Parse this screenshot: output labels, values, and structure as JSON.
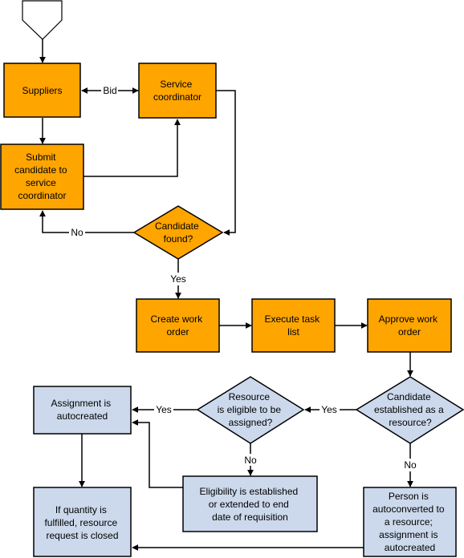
{
  "colors": {
    "process_orange": "#FFA500",
    "process_blue": "#CCD9EC",
    "stroke": "#000000",
    "background": "#FFFFFF"
  },
  "nodes": {
    "start": {
      "type": "off-page-connector",
      "label": ""
    },
    "suppliers": {
      "type": "process",
      "lines": [
        "Suppliers"
      ]
    },
    "service_coordinator": {
      "type": "process",
      "lines": [
        "Service",
        "coordinator"
      ]
    },
    "submit_candidate": {
      "type": "process",
      "lines": [
        "Submit",
        "candidate to",
        "service",
        "coordinator"
      ]
    },
    "candidate_found": {
      "type": "decision",
      "lines": [
        "Candidate",
        "found?"
      ]
    },
    "create_work_order": {
      "type": "process",
      "lines": [
        "Create work",
        "order"
      ]
    },
    "execute_task_list": {
      "type": "process",
      "lines": [
        "Execute task",
        "list"
      ]
    },
    "approve_work_order": {
      "type": "process",
      "lines": [
        "Approve work",
        "order"
      ]
    },
    "candidate_established": {
      "type": "decision",
      "lines": [
        "Candidate",
        "established as a",
        "resource?"
      ]
    },
    "resource_eligible": {
      "type": "decision",
      "lines": [
        "Resource",
        "is eligible to be",
        "assigned?"
      ]
    },
    "assignment_autocreated": {
      "type": "process",
      "lines": [
        "Assignment is",
        "autocreated"
      ]
    },
    "eligibility_established": {
      "type": "process",
      "lines": [
        "Eligibility is established",
        "or extended to end",
        "date of requisition"
      ]
    },
    "person_autoconverted": {
      "type": "process",
      "lines": [
        "Person is",
        "autoconverted to",
        "a resource;",
        "assignment is",
        "autocreated"
      ]
    },
    "quantity_fulfilled": {
      "type": "process",
      "lines": [
        "If quantity is",
        "fulfilled, resource",
        "request is closed"
      ]
    }
  },
  "edges": [
    {
      "from": "start",
      "to": "suppliers",
      "label": ""
    },
    {
      "from": "suppliers",
      "to": "service_coordinator",
      "label": "Bid",
      "bidirectional": true
    },
    {
      "from": "suppliers",
      "to": "submit_candidate",
      "label": ""
    },
    {
      "from": "submit_candidate",
      "to": "service_coordinator",
      "label": ""
    },
    {
      "from": "service_coordinator",
      "to": "candidate_found",
      "label": ""
    },
    {
      "from": "candidate_found",
      "to": "submit_candidate",
      "label": "No"
    },
    {
      "from": "candidate_found",
      "to": "create_work_order",
      "label": "Yes"
    },
    {
      "from": "create_work_order",
      "to": "execute_task_list",
      "label": ""
    },
    {
      "from": "execute_task_list",
      "to": "approve_work_order",
      "label": ""
    },
    {
      "from": "approve_work_order",
      "to": "candidate_established",
      "label": ""
    },
    {
      "from": "candidate_established",
      "to": "resource_eligible",
      "label": "Yes"
    },
    {
      "from": "candidate_established",
      "to": "person_autoconverted",
      "label": "No"
    },
    {
      "from": "resource_eligible",
      "to": "assignment_autocreated",
      "label": "Yes"
    },
    {
      "from": "resource_eligible",
      "to": "eligibility_established",
      "label": "No"
    },
    {
      "from": "eligibility_established",
      "to": "assignment_autocreated",
      "label": ""
    },
    {
      "from": "assignment_autocreated",
      "to": "quantity_fulfilled",
      "label": ""
    },
    {
      "from": "person_autoconverted",
      "to": "quantity_fulfilled",
      "label": ""
    }
  ],
  "edge_labels": {
    "bid": "Bid",
    "no_candidate": "No",
    "yes_candidate": "Yes",
    "yes_established": "Yes",
    "no_established": "No",
    "yes_eligible": "Yes",
    "no_eligible": "No"
  }
}
